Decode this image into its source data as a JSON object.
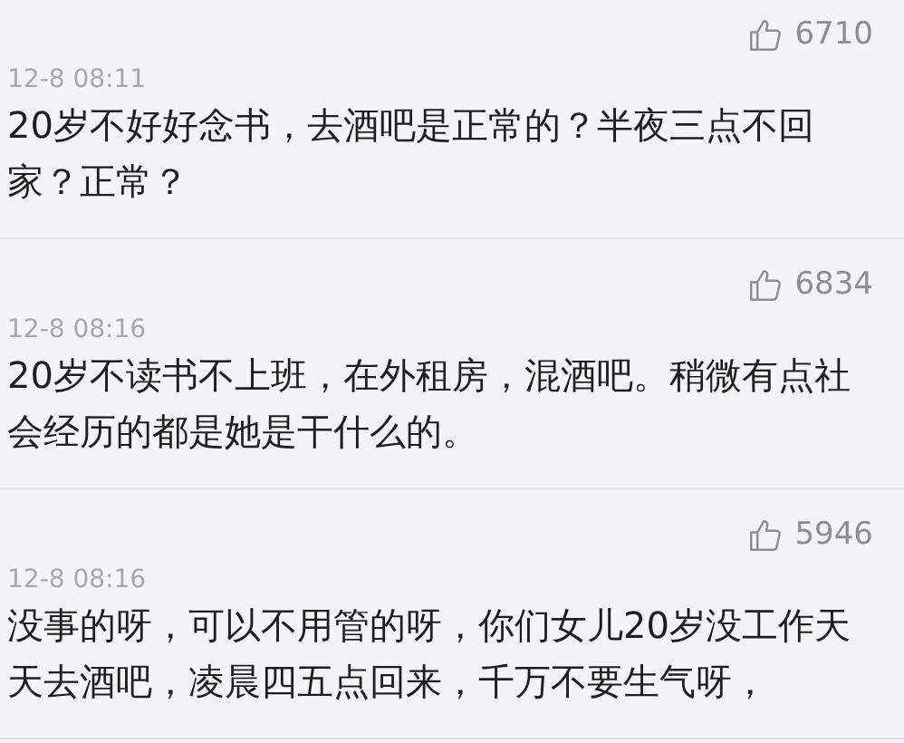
{
  "comments": [
    {
      "likes": "6710",
      "time": "12-8 08:11",
      "text": "20岁不好好念书，去酒吧是正常的？半夜三点不回家？正常？"
    },
    {
      "likes": "6834",
      "time": "12-8 08:16",
      "text": "20岁不读书不上班，在外租房，混酒吧。稍微有点社会经历的都是她是干什么的。"
    },
    {
      "likes": "5946",
      "time": "12-8 08:16",
      "text": "没事的呀，可以不用管的呀，你们女儿20岁没工作天天去酒吧，凌晨四五点回来，千万不要生气呀，"
    }
  ]
}
